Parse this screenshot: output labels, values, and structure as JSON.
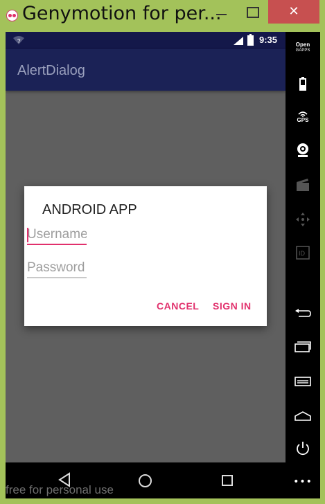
{
  "window": {
    "title": "Genymotion for per...",
    "close_glyph": "✕"
  },
  "status_bar": {
    "time": "9:35",
    "wifi_badge": "?"
  },
  "app_bar": {
    "title": "AlertDialog"
  },
  "dialog": {
    "title": "ANDROID APP",
    "username_placeholder": "Username",
    "username_value": "",
    "password_placeholder": "Password",
    "password_value": "",
    "cancel_label": "CANCEL",
    "signin_label": "SIGN IN"
  },
  "sidebar": {
    "gapps_line1": "Open",
    "gapps_line2": "GAPPS",
    "gps_label": "GPS",
    "id_label": "ID",
    "more_glyph": "•••"
  },
  "watermark": "free for personal use",
  "colors": {
    "accent": "#e1306c",
    "status_bar": "#14184a",
    "app_bar": "#1b2256",
    "window_frame": "#a3c25a",
    "close_button": "#c75050"
  }
}
